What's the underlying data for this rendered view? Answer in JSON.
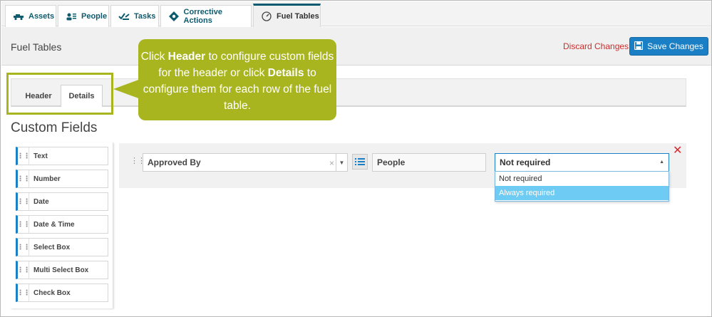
{
  "top_tabs": [
    {
      "label": "Assets",
      "icon": "truck-icon",
      "active": false
    },
    {
      "label": "People",
      "icon": "people-icon",
      "active": false
    },
    {
      "label": "Tasks",
      "icon": "tasks-icon",
      "active": false
    },
    {
      "label": "Corrective Actions",
      "icon": "wrench-diamond-icon",
      "active": false
    },
    {
      "label": "Fuel Tables",
      "icon": "gauge-icon",
      "active": true
    }
  ],
  "page": {
    "title": "Fuel Tables",
    "discard_label": "Discard Changes",
    "save_label": "Save Changes"
  },
  "sub_tabs": {
    "header": "Header",
    "details": "Details",
    "active": "Details"
  },
  "callout": {
    "p1": "Click ",
    "b1": "Header",
    "p2": " to configure custom fields for the header or click ",
    "b2": "Details",
    "p3": " to configure them for each row of the fuel table."
  },
  "section_title": "Custom Fields",
  "palette": [
    "Text",
    "Number",
    "Date",
    "Date & Time",
    "Select Box",
    "Multi Select Box",
    "Check Box"
  ],
  "field": {
    "name": "Approved By",
    "type": "People",
    "requirement": "Not required",
    "requirement_options": [
      "Not required",
      "Always required"
    ],
    "highlighted_option": "Always required"
  },
  "colors": {
    "accent": "#1a7fc4",
    "callout": "#a9b51f",
    "discard": "#cc2e2e",
    "tab_text": "#0e5a6e"
  }
}
